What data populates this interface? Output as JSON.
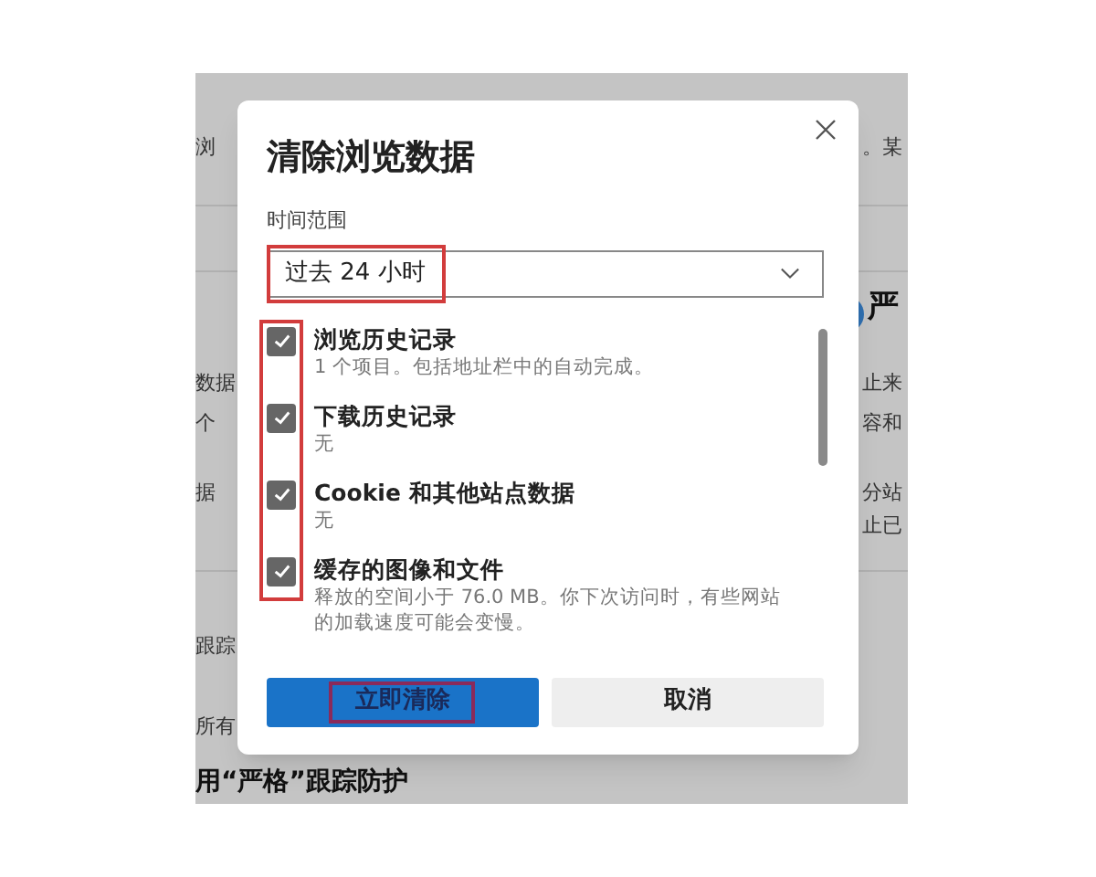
{
  "background": {
    "fragments": [
      {
        "text": "浏",
        "kind": "plain"
      },
      {
        "text": "。某",
        "kind": "plain"
      },
      {
        "text": "严",
        "kind": "heading"
      },
      {
        "text": "数据",
        "kind": "plain"
      },
      {
        "text": "止来",
        "kind": "plain"
      },
      {
        "text": "个",
        "kind": "plain"
      },
      {
        "text": "容和",
        "kind": "plain"
      },
      {
        "text": "据",
        "kind": "plain"
      },
      {
        "text": "分站",
        "kind": "plain"
      },
      {
        "text": "止已",
        "kind": "plain"
      },
      {
        "text": "跟踪",
        "kind": "plain"
      },
      {
        "text": "所有",
        "kind": "plain"
      },
      {
        "text": "用“严格”跟踪防护",
        "kind": "heading"
      }
    ]
  },
  "dialog": {
    "title": "清除浏览数据",
    "time_range": {
      "label": "时间范围",
      "value": "过去 24 小时",
      "highlighted": true
    },
    "checkboxes_highlighted": true,
    "items": [
      {
        "label": "浏览历史记录",
        "detail": "1 个项目。包括地址栏中的自动完成。",
        "checked": true
      },
      {
        "label": "下载历史记录",
        "detail": "无",
        "checked": true
      },
      {
        "label": "Cookie 和其他站点数据",
        "detail": "无",
        "checked": true
      },
      {
        "label": "缓存的图像和文件",
        "detail": "释放的空间小于 76.0 MB。你下次访问时，有些网站的加载速度可能会变慢。",
        "checked": true
      }
    ],
    "buttons": [
      {
        "label": "立即清除",
        "kind": "primary",
        "highlighted": true
      },
      {
        "label": "取消",
        "kind": "secondary",
        "highlighted": false
      }
    ]
  }
}
